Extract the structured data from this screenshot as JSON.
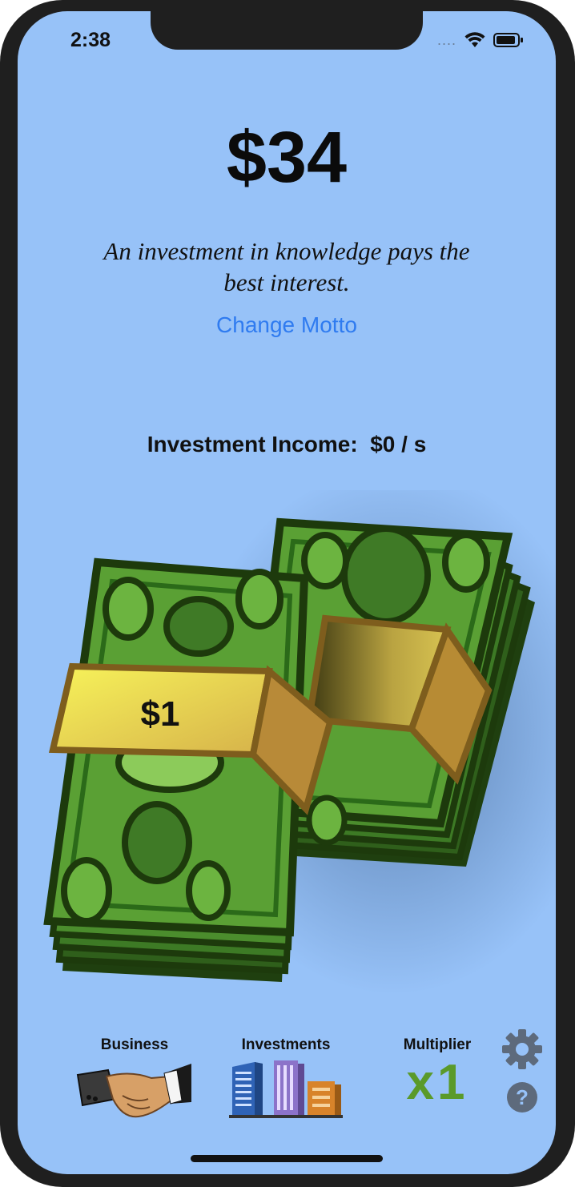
{
  "status_bar": {
    "time": "2:38",
    "signal": "....",
    "wifi_icon": "wifi-icon",
    "battery_icon": "battery-icon"
  },
  "balance": "$34",
  "motto": "An investment in knowledge pays the best interest.",
  "change_motto_label": "Change Motto",
  "income": {
    "label": "Investment Income:",
    "value": "$0 / s"
  },
  "cash_stack": {
    "bill_label": "$1",
    "icon": "cash-stack-icon"
  },
  "nav": {
    "business": {
      "label": "Business",
      "icon": "handshake-icon"
    },
    "investments": {
      "label": "Investments",
      "icon": "buildings-icon"
    },
    "multiplier": {
      "label": "Multiplier",
      "value": "x1"
    }
  },
  "side_buttons": {
    "settings_icon": "gear-icon",
    "help_icon": "help-icon"
  },
  "colors": {
    "background": "#97c2f8",
    "accent": "#2f7bf0",
    "multiplier": "#5a9a2a",
    "bill_green": "#4f9a34",
    "band_gold": "#e8c84a"
  }
}
